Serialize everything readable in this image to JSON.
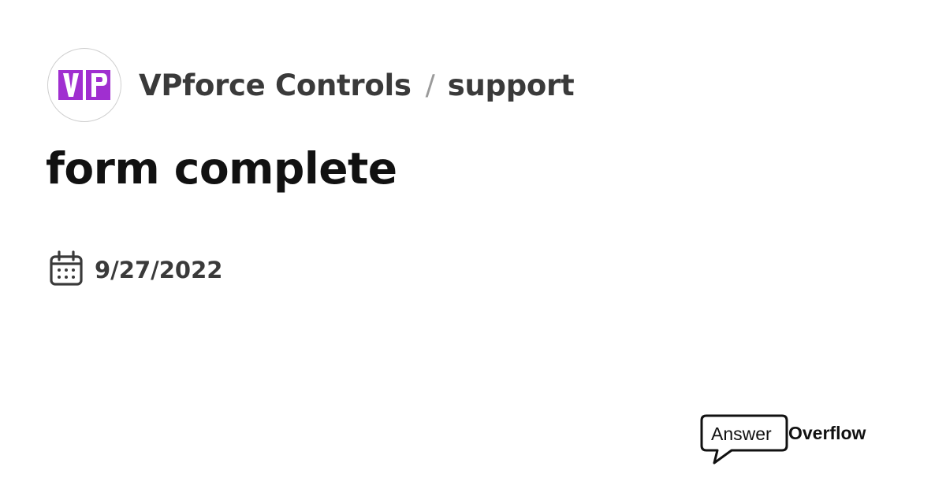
{
  "header": {
    "server_logo_text": "VP",
    "server_name": "VPforce Controls",
    "separator": "/",
    "channel_name": "support"
  },
  "thread": {
    "title": "form complete",
    "date": "9/27/2022"
  },
  "branding": {
    "word_plain": "Answer",
    "word_bold": "Overflow"
  },
  "icons": {
    "date": "calendar-icon",
    "brand": "speech-bubble-icon"
  },
  "colors": {
    "logo_purple": "#a02fd0",
    "text_dark": "#3a3a3a",
    "title": "#111111"
  }
}
